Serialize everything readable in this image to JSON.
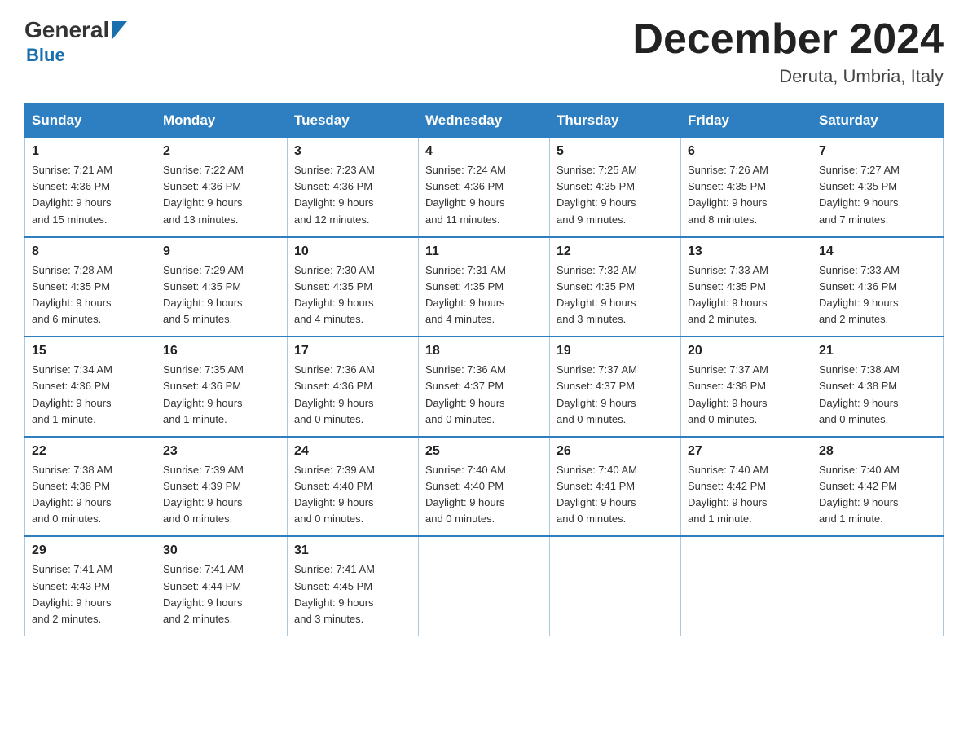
{
  "header": {
    "logo_general": "General",
    "logo_blue": "Blue",
    "month_title": "December 2024",
    "location": "Deruta, Umbria, Italy"
  },
  "days_of_week": [
    "Sunday",
    "Monday",
    "Tuesday",
    "Wednesday",
    "Thursday",
    "Friday",
    "Saturday"
  ],
  "weeks": [
    [
      {
        "day": "1",
        "info": "Sunrise: 7:21 AM\nSunset: 4:36 PM\nDaylight: 9 hours\nand 15 minutes."
      },
      {
        "day": "2",
        "info": "Sunrise: 7:22 AM\nSunset: 4:36 PM\nDaylight: 9 hours\nand 13 minutes."
      },
      {
        "day": "3",
        "info": "Sunrise: 7:23 AM\nSunset: 4:36 PM\nDaylight: 9 hours\nand 12 minutes."
      },
      {
        "day": "4",
        "info": "Sunrise: 7:24 AM\nSunset: 4:36 PM\nDaylight: 9 hours\nand 11 minutes."
      },
      {
        "day": "5",
        "info": "Sunrise: 7:25 AM\nSunset: 4:35 PM\nDaylight: 9 hours\nand 9 minutes."
      },
      {
        "day": "6",
        "info": "Sunrise: 7:26 AM\nSunset: 4:35 PM\nDaylight: 9 hours\nand 8 minutes."
      },
      {
        "day": "7",
        "info": "Sunrise: 7:27 AM\nSunset: 4:35 PM\nDaylight: 9 hours\nand 7 minutes."
      }
    ],
    [
      {
        "day": "8",
        "info": "Sunrise: 7:28 AM\nSunset: 4:35 PM\nDaylight: 9 hours\nand 6 minutes."
      },
      {
        "day": "9",
        "info": "Sunrise: 7:29 AM\nSunset: 4:35 PM\nDaylight: 9 hours\nand 5 minutes."
      },
      {
        "day": "10",
        "info": "Sunrise: 7:30 AM\nSunset: 4:35 PM\nDaylight: 9 hours\nand 4 minutes."
      },
      {
        "day": "11",
        "info": "Sunrise: 7:31 AM\nSunset: 4:35 PM\nDaylight: 9 hours\nand 4 minutes."
      },
      {
        "day": "12",
        "info": "Sunrise: 7:32 AM\nSunset: 4:35 PM\nDaylight: 9 hours\nand 3 minutes."
      },
      {
        "day": "13",
        "info": "Sunrise: 7:33 AM\nSunset: 4:35 PM\nDaylight: 9 hours\nand 2 minutes."
      },
      {
        "day": "14",
        "info": "Sunrise: 7:33 AM\nSunset: 4:36 PM\nDaylight: 9 hours\nand 2 minutes."
      }
    ],
    [
      {
        "day": "15",
        "info": "Sunrise: 7:34 AM\nSunset: 4:36 PM\nDaylight: 9 hours\nand 1 minute."
      },
      {
        "day": "16",
        "info": "Sunrise: 7:35 AM\nSunset: 4:36 PM\nDaylight: 9 hours\nand 1 minute."
      },
      {
        "day": "17",
        "info": "Sunrise: 7:36 AM\nSunset: 4:36 PM\nDaylight: 9 hours\nand 0 minutes."
      },
      {
        "day": "18",
        "info": "Sunrise: 7:36 AM\nSunset: 4:37 PM\nDaylight: 9 hours\nand 0 minutes."
      },
      {
        "day": "19",
        "info": "Sunrise: 7:37 AM\nSunset: 4:37 PM\nDaylight: 9 hours\nand 0 minutes."
      },
      {
        "day": "20",
        "info": "Sunrise: 7:37 AM\nSunset: 4:38 PM\nDaylight: 9 hours\nand 0 minutes."
      },
      {
        "day": "21",
        "info": "Sunrise: 7:38 AM\nSunset: 4:38 PM\nDaylight: 9 hours\nand 0 minutes."
      }
    ],
    [
      {
        "day": "22",
        "info": "Sunrise: 7:38 AM\nSunset: 4:38 PM\nDaylight: 9 hours\nand 0 minutes."
      },
      {
        "day": "23",
        "info": "Sunrise: 7:39 AM\nSunset: 4:39 PM\nDaylight: 9 hours\nand 0 minutes."
      },
      {
        "day": "24",
        "info": "Sunrise: 7:39 AM\nSunset: 4:40 PM\nDaylight: 9 hours\nand 0 minutes."
      },
      {
        "day": "25",
        "info": "Sunrise: 7:40 AM\nSunset: 4:40 PM\nDaylight: 9 hours\nand 0 minutes."
      },
      {
        "day": "26",
        "info": "Sunrise: 7:40 AM\nSunset: 4:41 PM\nDaylight: 9 hours\nand 0 minutes."
      },
      {
        "day": "27",
        "info": "Sunrise: 7:40 AM\nSunset: 4:42 PM\nDaylight: 9 hours\nand 1 minute."
      },
      {
        "day": "28",
        "info": "Sunrise: 7:40 AM\nSunset: 4:42 PM\nDaylight: 9 hours\nand 1 minute."
      }
    ],
    [
      {
        "day": "29",
        "info": "Sunrise: 7:41 AM\nSunset: 4:43 PM\nDaylight: 9 hours\nand 2 minutes."
      },
      {
        "day": "30",
        "info": "Sunrise: 7:41 AM\nSunset: 4:44 PM\nDaylight: 9 hours\nand 2 minutes."
      },
      {
        "day": "31",
        "info": "Sunrise: 7:41 AM\nSunset: 4:45 PM\nDaylight: 9 hours\nand 3 minutes."
      },
      {
        "day": "",
        "info": ""
      },
      {
        "day": "",
        "info": ""
      },
      {
        "day": "",
        "info": ""
      },
      {
        "day": "",
        "info": ""
      }
    ]
  ]
}
